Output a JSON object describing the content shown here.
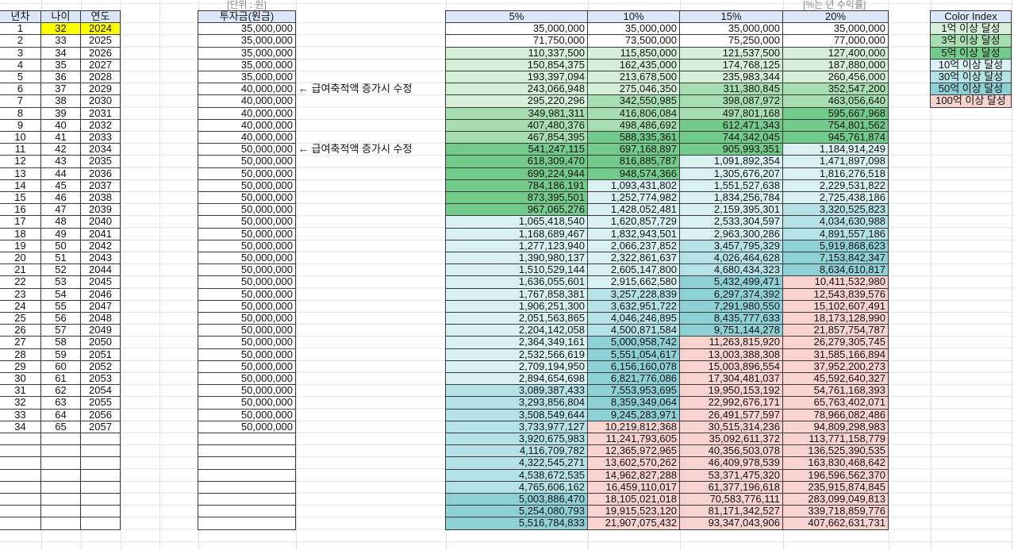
{
  "labels": {
    "unit": "[단위 : 원]",
    "rate_note": "[%는 년 수익률]",
    "row_note": "← 급여축적액 증가시 수정"
  },
  "left_headers": [
    "년차",
    "나이",
    "연도"
  ],
  "invest_header": "투자금(원금)",
  "rate_headers": [
    "5%",
    "10%",
    "15%",
    "20%"
  ],
  "highlight_color": "#ffff00",
  "legend": {
    "title": "Color Index",
    "title_color": "#dbe6f8",
    "items": [
      {
        "label": "1억 이상 달성",
        "threshold": 100000000,
        "color": "#d5efd9"
      },
      {
        "label": "3억 이상 달성",
        "threshold": 300000000,
        "color": "#a6deb2"
      },
      {
        "label": "5억 이상 달성",
        "threshold": 500000000,
        "color": "#73cb8b"
      },
      {
        "label": "10억 이상 달성",
        "threshold": 1000000000,
        "color": "#daf1f3"
      },
      {
        "label": "30억 이상 달성",
        "threshold": 3000000000,
        "color": "#b5e2e6"
      },
      {
        "label": "50억 이상 달성",
        "threshold": 5000000000,
        "color": "#8dd1d7"
      },
      {
        "label": "100억 이상 달성",
        "threshold": 10000000000,
        "color": "#f8d3d0"
      }
    ]
  },
  "rows_meta": [
    [
      "1",
      "32",
      "2024",
      "35,000,000",
      ""
    ],
    [
      "2",
      "33",
      "2025",
      "35,000,000",
      ""
    ],
    [
      "3",
      "34",
      "2026",
      "35,000,000",
      ""
    ],
    [
      "4",
      "35",
      "2027",
      "35,000,000",
      ""
    ],
    [
      "5",
      "36",
      "2028",
      "35,000,000",
      ""
    ],
    [
      "6",
      "37",
      "2029",
      "40,000,000",
      "note"
    ],
    [
      "7",
      "38",
      "2030",
      "40,000,000",
      ""
    ],
    [
      "8",
      "39",
      "2031",
      "40,000,000",
      ""
    ],
    [
      "9",
      "40",
      "2032",
      "40,000,000",
      ""
    ],
    [
      "10",
      "41",
      "2033",
      "40,000,000",
      ""
    ],
    [
      "11",
      "42",
      "2034",
      "50,000,000",
      "note"
    ],
    [
      "12",
      "43",
      "2035",
      "50,000,000",
      ""
    ],
    [
      "13",
      "44",
      "2036",
      "50,000,000",
      ""
    ],
    [
      "14",
      "45",
      "2037",
      "50,000,000",
      ""
    ],
    [
      "15",
      "46",
      "2038",
      "50,000,000",
      ""
    ],
    [
      "16",
      "47",
      "2039",
      "50,000,000",
      ""
    ],
    [
      "17",
      "48",
      "2040",
      "50,000,000",
      ""
    ],
    [
      "18",
      "49",
      "2041",
      "50,000,000",
      ""
    ],
    [
      "19",
      "50",
      "2042",
      "50,000,000",
      ""
    ],
    [
      "20",
      "51",
      "2043",
      "50,000,000",
      ""
    ],
    [
      "21",
      "52",
      "2044",
      "50,000,000",
      ""
    ],
    [
      "22",
      "53",
      "2045",
      "50,000,000",
      ""
    ],
    [
      "23",
      "54",
      "2046",
      "50,000,000",
      ""
    ],
    [
      "24",
      "55",
      "2047",
      "50,000,000",
      ""
    ],
    [
      "25",
      "56",
      "2048",
      "50,000,000",
      ""
    ],
    [
      "26",
      "57",
      "2049",
      "50,000,000",
      ""
    ],
    [
      "27",
      "58",
      "2050",
      "50,000,000",
      ""
    ],
    [
      "28",
      "59",
      "2051",
      "50,000,000",
      ""
    ],
    [
      "29",
      "60",
      "2052",
      "50,000,000",
      ""
    ],
    [
      "30",
      "61",
      "2053",
      "50,000,000",
      ""
    ],
    [
      "31",
      "62",
      "2054",
      "50,000,000",
      ""
    ],
    [
      "32",
      "63",
      "2055",
      "50,000,000",
      ""
    ],
    [
      "33",
      "64",
      "2056",
      "50,000,000",
      ""
    ],
    [
      "34",
      "65",
      "2057",
      "50,000,000",
      ""
    ],
    [
      "",
      "",
      "",
      "",
      ""
    ],
    [
      "",
      "",
      "",
      "",
      ""
    ],
    [
      "",
      "",
      "",
      "",
      ""
    ],
    [
      "",
      "",
      "",
      "",
      ""
    ],
    [
      "",
      "",
      "",
      "",
      ""
    ],
    [
      "",
      "",
      "",
      "",
      ""
    ],
    [
      "",
      "",
      "",
      "",
      ""
    ],
    [
      "",
      "",
      "",
      "",
      ""
    ]
  ],
  "rates": [
    [
      "35,000,000",
      "71,750,000",
      "110,337,500",
      "150,854,375",
      "193,397,094",
      "243,066,948",
      "295,220,296",
      "349,981,311",
      "407,480,376",
      "467,854,395",
      "541,247,115",
      "618,309,470",
      "699,224,944",
      "784,186,191",
      "873,395,501",
      "967,065,276",
      "1,065,418,540",
      "1,168,689,467",
      "1,277,123,940",
      "1,390,980,137",
      "1,510,529,144",
      "1,636,055,601",
      "1,767,858,381",
      "1,906,251,300",
      "2,051,563,865",
      "2,204,142,058",
      "2,364,349,161",
      "2,532,566,619",
      "2,709,194,950",
      "2,894,654,698",
      "3,089,387,433",
      "3,293,856,804",
      "3,508,549,644",
      "3,733,977,127",
      "3,920,675,983",
      "4,116,709,782",
      "4,322,545,271",
      "4,538,672,535",
      "4,765,606,162",
      "5,003,886,470",
      "5,254,080,793",
      "5,516,784,833"
    ],
    [
      "35,000,000",
      "73,500,000",
      "115,850,000",
      "162,435,000",
      "213,678,500",
      "275,046,350",
      "342,550,985",
      "416,806,084",
      "498,486,692",
      "588,335,361",
      "697,168,897",
      "816,885,787",
      "948,574,366",
      "1,093,431,802",
      "1,252,774,982",
      "1,428,052,481",
      "1,620,857,729",
      "1,832,943,501",
      "2,066,237,852",
      "2,322,861,637",
      "2,605,147,800",
      "2,915,662,580",
      "3,257,228,839",
      "3,632,951,722",
      "4,046,246,895",
      "4,500,871,584",
      "5,000,958,742",
      "5,551,054,617",
      "6,156,160,078",
      "6,821,776,086",
      "7,553,953,695",
      "8,359,349,064",
      "9,245,283,971",
      "10,219,812,368",
      "11,241,793,605",
      "12,365,972,965",
      "13,602,570,262",
      "14,962,827,288",
      "16,459,110,017",
      "18,105,021,018",
      "19,915,523,120",
      "21,907,075,432"
    ],
    [
      "35,000,000",
      "75,250,000",
      "121,537,500",
      "174,768,125",
      "235,983,344",
      "311,380,845",
      "398,087,972",
      "497,801,168",
      "612,471,343",
      "744,342,045",
      "905,993,351",
      "1,091,892,354",
      "1,305,676,207",
      "1,551,527,638",
      "1,834,256,784",
      "2,159,395,301",
      "2,533,304,597",
      "2,963,300,286",
      "3,457,795,329",
      "4,026,464,628",
      "4,680,434,323",
      "5,432,499,471",
      "6,297,374,392",
      "7,291,980,550",
      "8,435,777,633",
      "9,751,144,278",
      "11,263,815,920",
      "13,003,388,308",
      "15,003,896,554",
      "17,304,481,037",
      "19,950,153,192",
      "22,992,676,171",
      "26,491,577,597",
      "30,515,314,236",
      "35,092,611,372",
      "40,356,503,078",
      "46,409,978,539",
      "53,371,475,320",
      "61,377,196,618",
      "70,583,776,111",
      "81,171,342,527",
      "93,347,043,906"
    ],
    [
      "35,000,000",
      "77,000,000",
      "127,400,000",
      "187,880,000",
      "260,456,000",
      "352,547,200",
      "463,056,640",
      "595,667,968",
      "754,801,562",
      "945,761,874",
      "1,184,914,249",
      "1,471,897,098",
      "1,816,276,518",
      "2,229,531,822",
      "2,725,438,186",
      "3,320,525,823",
      "4,034,630,988",
      "4,891,557,186",
      "5,919,868,623",
      "7,153,842,347",
      "8,634,610,817",
      "10,411,532,980",
      "12,543,839,576",
      "15,102,607,491",
      "18,173,128,990",
      "21,857,754,787",
      "26,279,305,745",
      "31,585,166,894",
      "37,952,200,273",
      "45,592,640,327",
      "54,761,168,393",
      "65,763,402,071",
      "78,966,082,486",
      "94,809,298,983",
      "113,771,158,779",
      "136,525,390,535",
      "163,830,468,642",
      "196,596,562,370",
      "235,915,874,845",
      "283,099,049,813",
      "339,718,859,776",
      "407,662,631,731"
    ]
  ]
}
